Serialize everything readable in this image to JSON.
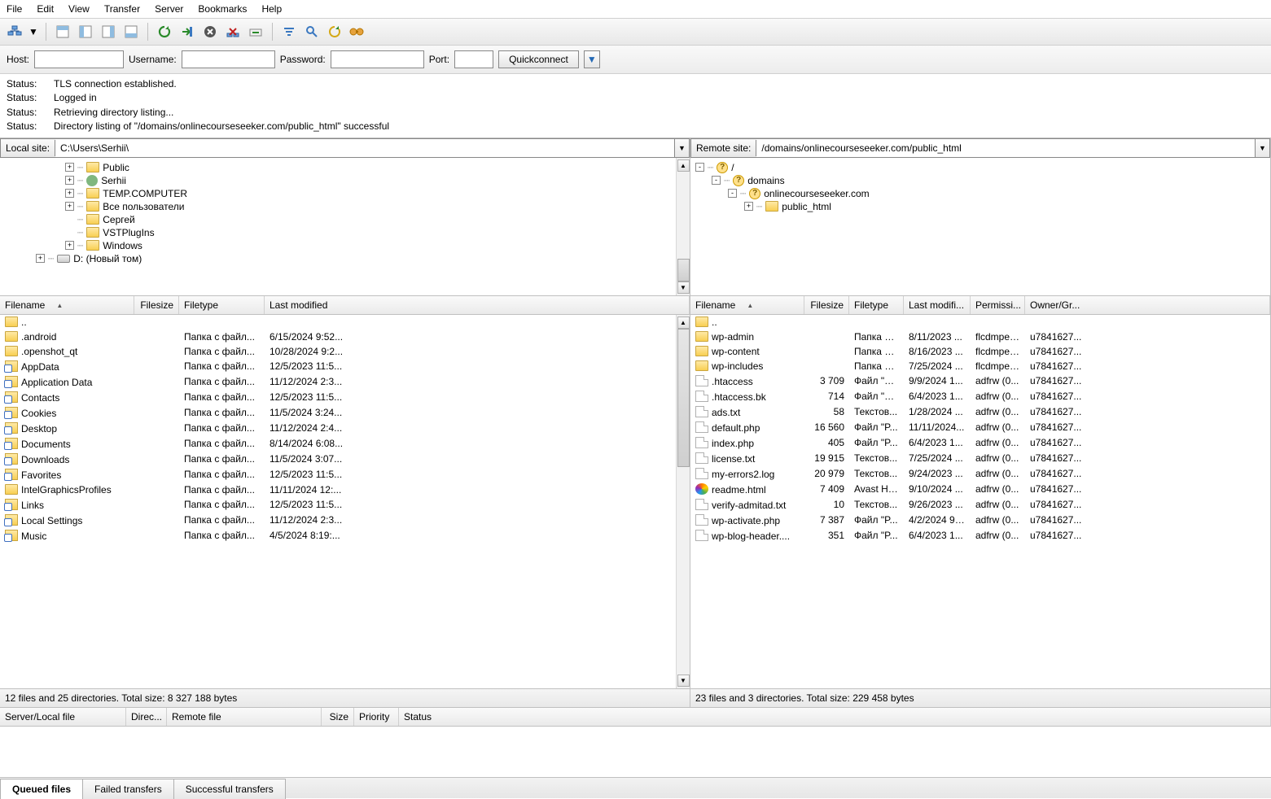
{
  "menu": [
    "File",
    "Edit",
    "View",
    "Transfer",
    "Server",
    "Bookmarks",
    "Help"
  ],
  "quick": {
    "host_lbl": "Host:",
    "user_lbl": "Username:",
    "pass_lbl": "Password:",
    "port_lbl": "Port:",
    "btn": "Quickconnect"
  },
  "log": [
    {
      "tag": "Status:",
      "msg": "TLS connection established."
    },
    {
      "tag": "Status:",
      "msg": "Logged in"
    },
    {
      "tag": "Status:",
      "msg": "Retrieving directory listing..."
    },
    {
      "tag": "Status:",
      "msg": "Directory listing of \"/domains/onlinecourseseeker.com/public_html\" successful"
    }
  ],
  "local": {
    "label": "Local site:",
    "path": "C:\\Users\\Serhii\\",
    "tree": [
      {
        "indent": 80,
        "exp": "+",
        "icon": "folder",
        "name": "Public"
      },
      {
        "indent": 80,
        "exp": "+",
        "icon": "user",
        "name": "Serhii"
      },
      {
        "indent": 80,
        "exp": "+",
        "icon": "folder",
        "name": "TEMP.COMPUTER"
      },
      {
        "indent": 80,
        "exp": "+",
        "icon": "folder",
        "name": "Все пользователи"
      },
      {
        "indent": 80,
        "exp": "",
        "icon": "folder",
        "name": "Сергей"
      },
      {
        "indent": 80,
        "exp": "",
        "icon": "folder",
        "name": "VSTPlugIns"
      },
      {
        "indent": 80,
        "exp": "+",
        "icon": "folder",
        "name": "Windows"
      },
      {
        "indent": 44,
        "exp": "+",
        "icon": "drive",
        "name": "D: (Новый том)"
      }
    ],
    "cols": {
      "name": "Filename",
      "size": "Filesize",
      "type": "Filetype",
      "mod": "Last modified"
    },
    "files": [
      {
        "ico": "folder",
        "name": "..",
        "size": "",
        "type": "",
        "mod": ""
      },
      {
        "ico": "folder",
        "name": ".android",
        "size": "",
        "type": "Папка с файл...",
        "mod": "6/15/2024 9:52..."
      },
      {
        "ico": "folder",
        "name": ".openshot_qt",
        "size": "",
        "type": "Папка с файл...",
        "mod": "10/28/2024 9:2..."
      },
      {
        "ico": "link",
        "name": "AppData",
        "size": "",
        "type": "Папка с файл...",
        "mod": "12/5/2023 11:5..."
      },
      {
        "ico": "link",
        "name": "Application Data",
        "size": "",
        "type": "Папка с файл...",
        "mod": "11/12/2024 2:3..."
      },
      {
        "ico": "link",
        "name": "Contacts",
        "size": "",
        "type": "Папка с файл...",
        "mod": "12/5/2023 11:5..."
      },
      {
        "ico": "link",
        "name": "Cookies",
        "size": "",
        "type": "Папка с файл...",
        "mod": "11/5/2024 3:24..."
      },
      {
        "ico": "link",
        "name": "Desktop",
        "size": "",
        "type": "Папка с файл...",
        "mod": "11/12/2024 2:4..."
      },
      {
        "ico": "link",
        "name": "Documents",
        "size": "",
        "type": "Папка с файл...",
        "mod": "8/14/2024 6:08..."
      },
      {
        "ico": "link",
        "name": "Downloads",
        "size": "",
        "type": "Папка с файл...",
        "mod": "11/5/2024 3:07..."
      },
      {
        "ico": "link",
        "name": "Favorites",
        "size": "",
        "type": "Папка с файл...",
        "mod": "12/5/2023 11:5..."
      },
      {
        "ico": "folder",
        "name": "IntelGraphicsProfiles",
        "size": "",
        "type": "Папка с файл...",
        "mod": "11/11/2024 12:..."
      },
      {
        "ico": "link",
        "name": "Links",
        "size": "",
        "type": "Папка с файл...",
        "mod": "12/5/2023 11:5..."
      },
      {
        "ico": "link",
        "name": "Local Settings",
        "size": "",
        "type": "Папка с файл...",
        "mod": "11/12/2024 2:3..."
      },
      {
        "ico": "link",
        "name": "Music",
        "size": "",
        "type": "Папка с файл...",
        "mod": "4/5/2024 8:19:..."
      }
    ],
    "status": "12 files and 25 directories. Total size: 8 327 188 bytes"
  },
  "remote": {
    "label": "Remote site:",
    "path": "/domains/onlinecourseseeker.com/public_html",
    "tree": [
      {
        "indent": 6,
        "exp": "-",
        "icon": "q",
        "name": "/"
      },
      {
        "indent": 26,
        "exp": "-",
        "icon": "q",
        "name": "domains"
      },
      {
        "indent": 46,
        "exp": "-",
        "icon": "q",
        "name": "onlinecourseseeker.com"
      },
      {
        "indent": 66,
        "exp": "+",
        "icon": "folder",
        "name": "public_html"
      }
    ],
    "cols": {
      "name": "Filename",
      "size": "Filesize",
      "type": "Filetype",
      "mod": "Last modifi...",
      "perm": "Permissi...",
      "own": "Owner/Gr..."
    },
    "files": [
      {
        "ico": "folder",
        "name": "..",
        "size": "",
        "type": "",
        "mod": "",
        "perm": "",
        "own": ""
      },
      {
        "ico": "folder",
        "name": "wp-admin",
        "size": "",
        "type": "Папка с ...",
        "mod": "8/11/2023 ...",
        "perm": "flcdmpe ...",
        "own": "u7841627..."
      },
      {
        "ico": "folder",
        "name": "wp-content",
        "size": "",
        "type": "Папка с ...",
        "mod": "8/16/2023 ...",
        "perm": "flcdmpe ...",
        "own": "u7841627..."
      },
      {
        "ico": "folder",
        "name": "wp-includes",
        "size": "",
        "type": "Папка с ...",
        "mod": "7/25/2024 ...",
        "perm": "flcdmpe ...",
        "own": "u7841627..."
      },
      {
        "ico": "file",
        "name": ".htaccess",
        "size": "3 709",
        "type": "Файл \"H...",
        "mod": "9/9/2024 1...",
        "perm": "adfrw (0...",
        "own": "u7841627..."
      },
      {
        "ico": "file",
        "name": ".htaccess.bk",
        "size": "714",
        "type": "Файл \"B...",
        "mod": "6/4/2023 1...",
        "perm": "adfrw (0...",
        "own": "u7841627..."
      },
      {
        "ico": "file",
        "name": "ads.txt",
        "size": "58",
        "type": "Текстов...",
        "mod": "1/28/2024 ...",
        "perm": "adfrw (0...",
        "own": "u7841627..."
      },
      {
        "ico": "file",
        "name": "default.php",
        "size": "16 560",
        "type": "Файл \"P...",
        "mod": "11/11/2024...",
        "perm": "adfrw (0...",
        "own": "u7841627..."
      },
      {
        "ico": "file",
        "name": "index.php",
        "size": "405",
        "type": "Файл \"P...",
        "mod": "6/4/2023 1...",
        "perm": "adfrw (0...",
        "own": "u7841627..."
      },
      {
        "ico": "file",
        "name": "license.txt",
        "size": "19 915",
        "type": "Текстов...",
        "mod": "7/25/2024 ...",
        "perm": "adfrw (0...",
        "own": "u7841627..."
      },
      {
        "ico": "file",
        "name": "my-errors2.log",
        "size": "20 979",
        "type": "Текстов...",
        "mod": "9/24/2023 ...",
        "perm": "adfrw (0...",
        "own": "u7841627..."
      },
      {
        "ico": "html",
        "name": "readme.html",
        "size": "7 409",
        "type": "Avast HT...",
        "mod": "9/10/2024 ...",
        "perm": "adfrw (0...",
        "own": "u7841627..."
      },
      {
        "ico": "file",
        "name": "verify-admitad.txt",
        "size": "10",
        "type": "Текстов...",
        "mod": "9/26/2023 ...",
        "perm": "adfrw (0...",
        "own": "u7841627..."
      },
      {
        "ico": "file",
        "name": "wp-activate.php",
        "size": "7 387",
        "type": "Файл \"P...",
        "mod": "4/2/2024 9:...",
        "perm": "adfrw (0...",
        "own": "u7841627..."
      },
      {
        "ico": "file",
        "name": "wp-blog-header....",
        "size": "351",
        "type": "Файл \"P...",
        "mod": "6/4/2023 1...",
        "perm": "adfrw (0...",
        "own": "u7841627..."
      }
    ],
    "status": "23 files and 3 directories. Total size: 229 458 bytes"
  },
  "queue": {
    "cols": [
      "Server/Local file",
      "Direc...",
      "Remote file",
      "Size",
      "Priority",
      "Status"
    ]
  },
  "tabs": [
    "Queued files",
    "Failed transfers",
    "Successful transfers"
  ]
}
